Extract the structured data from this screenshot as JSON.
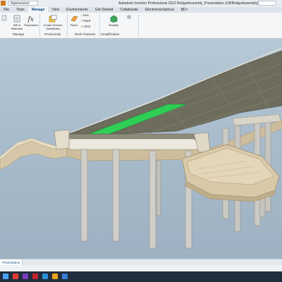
{
  "titlebar": {
    "workspace_label": "Appearance",
    "title": "Autodesk Inventor Professional 2022   BridgeAssembly_Presentation (ORBridgeAssembly)"
  },
  "ribbon_tabs": [
    "File",
    "Tools",
    "Manage",
    "View",
    "Environments",
    "Get Started",
    "Collaborate",
    "Electromechanical",
    "BD+"
  ],
  "ribbon": {
    "manage_buttons": [
      "Bill of Materials",
      "Parameters"
    ],
    "productivity_button": "Create Derived Substitutes",
    "work_features": {
      "plane": "Plane",
      "axis": "Axis",
      "point": "Point",
      "ucs": "UCS"
    },
    "simplify_button": "Simplify",
    "group_labels": {
      "manage": "Manage",
      "productivity": "Productivity",
      "work_features": "Work Features",
      "simplification": "Simplification"
    }
  },
  "doc_tab": {
    "label": "Presentation"
  },
  "colors": {
    "highlight": "#2fcf55",
    "deck_top": "#6d6b5c",
    "concrete": "#d9cbb0",
    "pier": "#c9c9c4"
  }
}
